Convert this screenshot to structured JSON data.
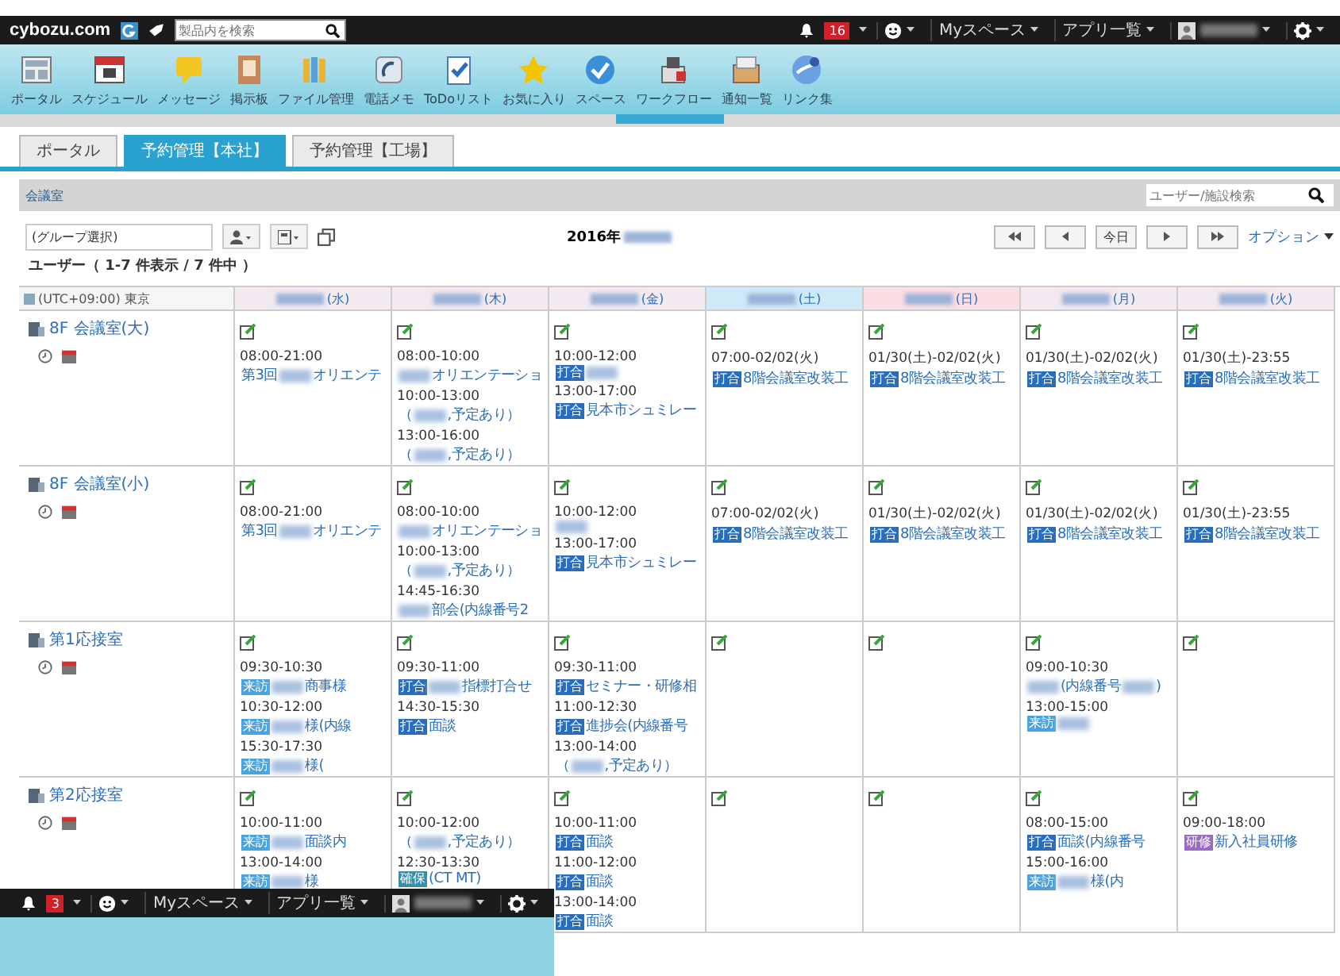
{
  "header": {
    "logo": "cybozu.com",
    "search_placeholder": "製品内を検索",
    "notification_count": "16",
    "menus": [
      "Myスペース",
      "アプリ一覧"
    ]
  },
  "apps": [
    {
      "label": "ポータル"
    },
    {
      "label": "スケジュール"
    },
    {
      "label": "メッセージ"
    },
    {
      "label": "掲示板"
    },
    {
      "label": "ファイル管理"
    },
    {
      "label": "電話メモ"
    },
    {
      "label": "ToDoリスト"
    },
    {
      "label": "お気に入り"
    },
    {
      "label": "スペース"
    },
    {
      "label": "ワークフロー"
    },
    {
      "label": "通知一覧"
    },
    {
      "label": "リンク集"
    }
  ],
  "tabs": [
    {
      "label": "ポータル",
      "selected": false
    },
    {
      "label": "予約管理【本社】",
      "selected": true
    },
    {
      "label": "予約管理【工場】",
      "selected": false
    }
  ],
  "panel": {
    "title": "会議室",
    "search_placeholder": "ユーザー/施設検索",
    "group_select": "(グループ選択)",
    "year": "2016年",
    "today": "今日",
    "options": "オプション",
    "count": "ユーザー（ 1-7 件表示 / 7 件中 ）",
    "timezone": "(UTC+09:00) 東京"
  },
  "days": [
    {
      "label": "(水)",
      "kind": "weekday"
    },
    {
      "label": "(木)",
      "kind": "weekday"
    },
    {
      "label": "(金)",
      "kind": "weekday"
    },
    {
      "label": "(土)",
      "kind": "saturday"
    },
    {
      "label": "(日)",
      "kind": "sunday"
    },
    {
      "label": "(月)",
      "kind": "weekday"
    },
    {
      "label": "(火)",
      "kind": "weekday"
    }
  ],
  "facilities": [
    {
      "name": "8F 会議室(大)",
      "cells": [
        [
          {
            "time": "08:00-21:00",
            "parts": [
              {
                "kind": "text",
                "text": "第3回"
              },
              {
                "kind": "blurred"
              },
              {
                "kind": "text",
                "text": "オリエンテ"
              }
            ]
          }
        ],
        [
          {
            "time": "08:00-10:00",
            "parts": [
              {
                "kind": "blurred"
              },
              {
                "kind": "text",
                "text": "オリエンテーショ"
              }
            ]
          },
          {
            "time": "10:00-13:00",
            "parts": [
              {
                "kind": "text",
                "text": "（"
              },
              {
                "kind": "blurred"
              },
              {
                "kind": "text",
                "text": ",予定あり）"
              }
            ]
          },
          {
            "time": "13:00-16:00",
            "parts": [
              {
                "kind": "text",
                "text": "（"
              },
              {
                "kind": "blurred"
              },
              {
                "kind": "text",
                "text": ",予定あり）"
              }
            ]
          }
        ],
        [
          {
            "time": "10:00-12:00",
            "parts": [
              {
                "kind": "tag",
                "label": "打合",
                "color": "#2a6ebb"
              },
              {
                "kind": "blurred"
              }
            ]
          },
          {
            "time": "13:00-17:00",
            "parts": [
              {
                "kind": "tag",
                "label": "打合",
                "color": "#2a6ebb"
              },
              {
                "kind": "text",
                "text": "見本市シュミレー"
              }
            ]
          }
        ],
        [
          {
            "time": "07:00-02/02(火)",
            "parts": [
              {
                "kind": "tag",
                "label": "打合",
                "color": "#2a6ebb"
              },
              {
                "kind": "text",
                "text": "8階会議室改装工"
              }
            ]
          }
        ],
        [
          {
            "time": "01/30(土)-02/02(火)",
            "parts": [
              {
                "kind": "tag",
                "label": "打合",
                "color": "#2a6ebb"
              },
              {
                "kind": "text",
                "text": "8階会議室改装工"
              }
            ]
          }
        ],
        [
          {
            "time": "01/30(土)-02/02(火)",
            "parts": [
              {
                "kind": "tag",
                "label": "打合",
                "color": "#2a6ebb"
              },
              {
                "kind": "text",
                "text": "8階会議室改装工"
              }
            ]
          }
        ],
        [
          {
            "time": "01/30(土)-23:55",
            "parts": [
              {
                "kind": "tag",
                "label": "打合",
                "color": "#2a6ebb"
              },
              {
                "kind": "text",
                "text": "8階会議室改装工"
              }
            ]
          }
        ]
      ]
    },
    {
      "name": "8F 会議室(小)",
      "cells": [
        [
          {
            "time": "08:00-21:00",
            "parts": [
              {
                "kind": "text",
                "text": "第3回"
              },
              {
                "kind": "blurred"
              },
              {
                "kind": "text",
                "text": "オリエンテ"
              }
            ]
          }
        ],
        [
          {
            "time": "08:00-10:00",
            "parts": [
              {
                "kind": "blurred"
              },
              {
                "kind": "text",
                "text": "オリエンテーショ"
              }
            ]
          },
          {
            "time": "10:00-13:00",
            "parts": [
              {
                "kind": "text",
                "text": "（"
              },
              {
                "kind": "blurred"
              },
              {
                "kind": "text",
                "text": ",予定あり）"
              }
            ]
          },
          {
            "time": "14:45-16:30",
            "parts": [
              {
                "kind": "blurred"
              },
              {
                "kind": "text",
                "text": "部会(内線番号2"
              }
            ]
          }
        ],
        [
          {
            "time": "10:00-12:00",
            "parts": [
              {
                "kind": "blurred"
              }
            ]
          },
          {
            "time": "13:00-17:00",
            "parts": [
              {
                "kind": "tag",
                "label": "打合",
                "color": "#2a6ebb"
              },
              {
                "kind": "text",
                "text": "見本市シュミレー"
              }
            ]
          }
        ],
        [
          {
            "time": "07:00-02/02(火)",
            "parts": [
              {
                "kind": "tag",
                "label": "打合",
                "color": "#2a6ebb"
              },
              {
                "kind": "text",
                "text": "8階会議室改装工"
              }
            ]
          }
        ],
        [
          {
            "time": "01/30(土)-02/02(火)",
            "parts": [
              {
                "kind": "tag",
                "label": "打合",
                "color": "#2a6ebb"
              },
              {
                "kind": "text",
                "text": "8階会議室改装工"
              }
            ]
          }
        ],
        [
          {
            "time": "01/30(土)-02/02(火)",
            "parts": [
              {
                "kind": "tag",
                "label": "打合",
                "color": "#2a6ebb"
              },
              {
                "kind": "text",
                "text": "8階会議室改装工"
              }
            ]
          }
        ],
        [
          {
            "time": "01/30(土)-23:55",
            "parts": [
              {
                "kind": "tag",
                "label": "打合",
                "color": "#2a6ebb"
              },
              {
                "kind": "text",
                "text": "8階会議室改装工"
              }
            ]
          }
        ]
      ]
    },
    {
      "name": "第1応接室",
      "cells": [
        [
          {
            "time": "09:30-10:30",
            "parts": [
              {
                "kind": "tag",
                "label": "来訪",
                "color": "#4aa3df"
              },
              {
                "kind": "blurred"
              },
              {
                "kind": "text",
                "text": "商事様"
              }
            ]
          },
          {
            "time": "10:30-12:00",
            "parts": [
              {
                "kind": "tag",
                "label": "来訪",
                "color": "#4aa3df"
              },
              {
                "kind": "blurred"
              },
              {
                "kind": "text",
                "text": "様(内線"
              }
            ]
          },
          {
            "time": "15:30-17:30",
            "parts": [
              {
                "kind": "tag",
                "label": "来訪",
                "color": "#4aa3df"
              },
              {
                "kind": "blurred"
              },
              {
                "kind": "text",
                "text": "様("
              }
            ]
          }
        ],
        [
          {
            "time": "09:30-11:00",
            "parts": [
              {
                "kind": "tag",
                "label": "打合",
                "color": "#2a6ebb"
              },
              {
                "kind": "blurred"
              },
              {
                "kind": "text",
                "text": "指標打合せ"
              }
            ]
          },
          {
            "time": "14:30-15:30",
            "parts": [
              {
                "kind": "tag",
                "label": "打合",
                "color": "#2a6ebb"
              },
              {
                "kind": "text",
                "text": "面談"
              }
            ]
          }
        ],
        [
          {
            "time": "09:30-11:00",
            "parts": [
              {
                "kind": "tag",
                "label": "打合",
                "color": "#2a6ebb"
              },
              {
                "kind": "text",
                "text": "セミナー・研修相"
              }
            ]
          },
          {
            "time": "11:00-12:30",
            "parts": [
              {
                "kind": "tag",
                "label": "打合",
                "color": "#2a6ebb"
              },
              {
                "kind": "text",
                "text": "進捗会(内線番号"
              }
            ]
          },
          {
            "time": "13:00-14:00",
            "parts": [
              {
                "kind": "text",
                "text": "（"
              },
              {
                "kind": "blurred"
              },
              {
                "kind": "text",
                "text": ",予定あり）"
              }
            ]
          }
        ],
        [],
        [],
        [
          {
            "time": "09:00-10:30",
            "parts": [
              {
                "kind": "blurred"
              },
              {
                "kind": "text",
                "text": "(内線番号"
              },
              {
                "kind": "blurred"
              },
              {
                "kind": "text",
                "text": ")"
              }
            ]
          },
          {
            "time": "13:00-15:00",
            "parts": [
              {
                "kind": "tag",
                "label": "来訪",
                "color": "#4aa3df"
              },
              {
                "kind": "blurred"
              }
            ]
          }
        ],
        []
      ]
    },
    {
      "name": "第2応接室",
      "cells": [
        [
          {
            "time": "10:00-11:00",
            "parts": [
              {
                "kind": "tag",
                "label": "来訪",
                "color": "#4aa3df"
              },
              {
                "kind": "blurred"
              },
              {
                "kind": "text",
                "text": "面談内"
              }
            ]
          },
          {
            "time": "13:00-14:00",
            "parts": [
              {
                "kind": "tag",
                "label": "来訪",
                "color": "#4aa3df"
              },
              {
                "kind": "blurred"
              },
              {
                "kind": "text",
                "text": "様"
              }
            ]
          }
        ],
        [
          {
            "time": "10:00-12:00",
            "parts": [
              {
                "kind": "text",
                "text": "（"
              },
              {
                "kind": "blurred"
              },
              {
                "kind": "text",
                "text": ",予定あり）"
              }
            ]
          },
          {
            "time": "12:30-13:30",
            "parts": [
              {
                "kind": "tag",
                "label": "確保",
                "color": "#3a8fa8"
              },
              {
                "kind": "text",
                "text": "(CT MT)"
              }
            ]
          }
        ],
        [
          {
            "time": "10:00-11:00",
            "parts": [
              {
                "kind": "tag",
                "label": "打合",
                "color": "#2a6ebb"
              },
              {
                "kind": "text",
                "text": "面談"
              }
            ]
          },
          {
            "time": "11:00-12:00",
            "parts": [
              {
                "kind": "tag",
                "label": "打合",
                "color": "#2a6ebb"
              },
              {
                "kind": "text",
                "text": "面談"
              }
            ]
          },
          {
            "time": "13:00-14:00",
            "parts": [
              {
                "kind": "tag",
                "label": "打合",
                "color": "#2a6ebb"
              },
              {
                "kind": "text",
                "text": "面談"
              }
            ]
          }
        ],
        [],
        [],
        [
          {
            "time": "08:00-15:00",
            "parts": [
              {
                "kind": "tag",
                "label": "打合",
                "color": "#2a6ebb"
              },
              {
                "kind": "text",
                "text": "面談(内線番号"
              }
            ]
          },
          {
            "time": "15:00-16:00",
            "parts": [
              {
                "kind": "tag",
                "label": "来訪",
                "color": "#4aa3df"
              },
              {
                "kind": "blurred"
              },
              {
                "kind": "text",
                "text": "様(内"
              }
            ]
          }
        ],
        [
          {
            "time": "09:00-18:00",
            "parts": [
              {
                "kind": "tag",
                "label": "研修",
                "color": "#9b6bc4"
              },
              {
                "kind": "text",
                "text": "新入社員研修"
              }
            ]
          }
        ]
      ]
    }
  ],
  "overlay": {
    "notification_count": "3",
    "menus": [
      "Myスペース",
      "アプリ一覧"
    ]
  }
}
